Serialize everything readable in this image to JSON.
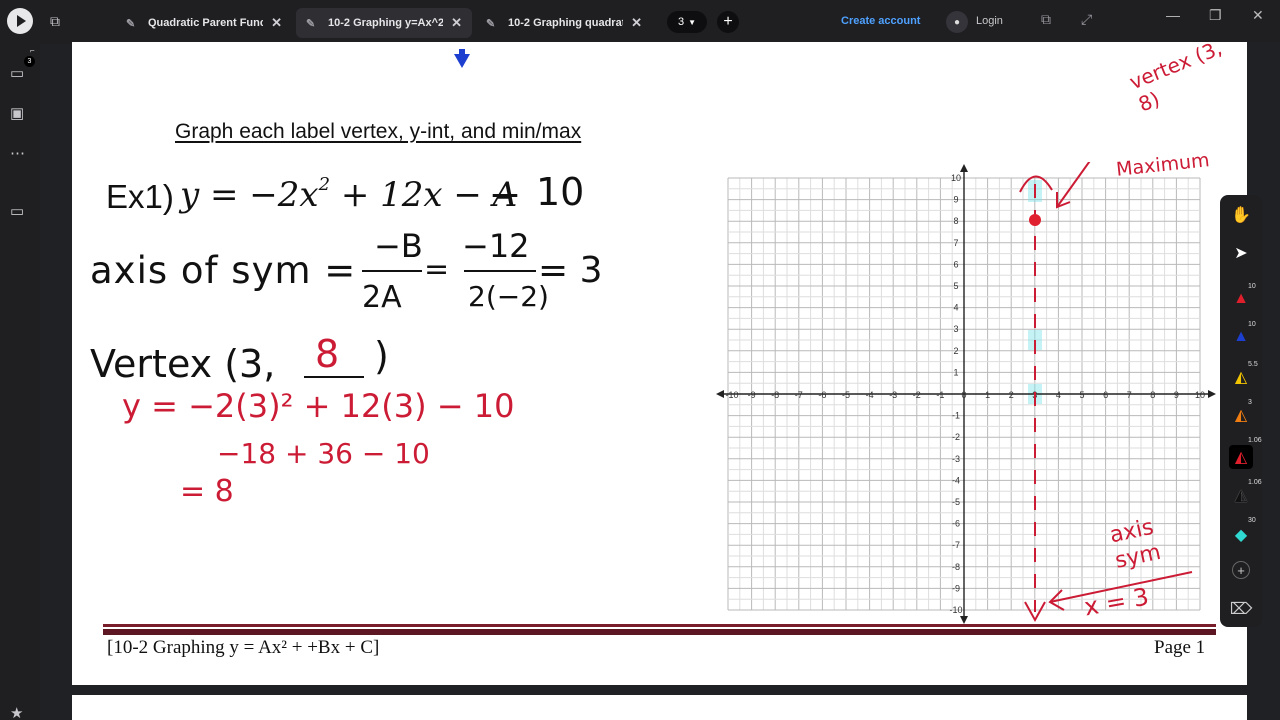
{
  "tabs": [
    {
      "label": "Quadratic Parent Funct...*",
      "active": false
    },
    {
      "label": "10-2 Graphing y=Ax^2...*",
      "active": true
    },
    {
      "label": "10-2 Graphing quadrat...",
      "active": false
    }
  ],
  "toolbar": {
    "page_count": "3",
    "create_account": "Create account",
    "login": "Login"
  },
  "left_rail": {
    "badge": "3"
  },
  "document": {
    "heading": "Graph each label vertex, y-int, and min/max",
    "example_label": "Ex1)",
    "equation_lhs": "y = −2x",
    "equation_exp": "2",
    "equation_rhs": " + 12x − ",
    "equation_struck": "A",
    "equation_hand_const": "10",
    "axis_of_sym": "axis of sym = ",
    "axis_num": "−B",
    "axis_den": "2A",
    "axis_num2": "−12",
    "axis_den2": "2(−2)",
    "axis_result": "= 3",
    "vertex_text": "Vertex (3,",
    "vertex_y": "8",
    "vertex_close": ")",
    "work_line1": "y = −2(3)² + 12(3) − 10",
    "work_line2": "−18 + 36 − 10",
    "work_line3": "= 8",
    "annot_vertex": "vertex (3, 8)",
    "annot_max": "Maximum",
    "annot_axis_sym": "axis sym",
    "annot_x3": "x = 3",
    "footer_left": "[10-2 Graphing y = Ax² + +Bx + C]",
    "footer_right": "Page 1"
  },
  "graph": {
    "x_ticks": [
      "-10",
      "-9",
      "-8",
      "-7",
      "-6",
      "-5",
      "-4",
      "-3",
      "-2",
      "-1",
      "0",
      "1",
      "2",
      "3",
      "4",
      "5",
      "6",
      "7",
      "8",
      "9",
      "10"
    ],
    "y_ticks": [
      "10",
      "9",
      "8",
      "7",
      "6",
      "5",
      "4",
      "3",
      "2",
      "1",
      "-1",
      "-2",
      "-3",
      "-4",
      "-5",
      "-6",
      "-7",
      "-8",
      "-9",
      "-10"
    ]
  },
  "tools": [
    {
      "icon": "hand-icon",
      "num": ""
    },
    {
      "icon": "pointer-icon",
      "num": ""
    },
    {
      "icon": "red-pen-icon",
      "num": "10"
    },
    {
      "icon": "blue-pen-icon",
      "num": "10"
    },
    {
      "icon": "yellow-highlighter-icon",
      "num": "5.5"
    },
    {
      "icon": "orange-highlighter-icon",
      "num": "3"
    },
    {
      "icon": "red-marker-icon",
      "num": "1.06"
    },
    {
      "icon": "black-pen-icon",
      "num": "1.06"
    },
    {
      "icon": "cyan-highlighter-icon",
      "num": "30"
    }
  ],
  "colors": {
    "ink_red": "#cc1b35",
    "ink_black": "#111111",
    "accent_blue": "#4ea1ff",
    "highlight_cyan": "#7fe3e6"
  }
}
